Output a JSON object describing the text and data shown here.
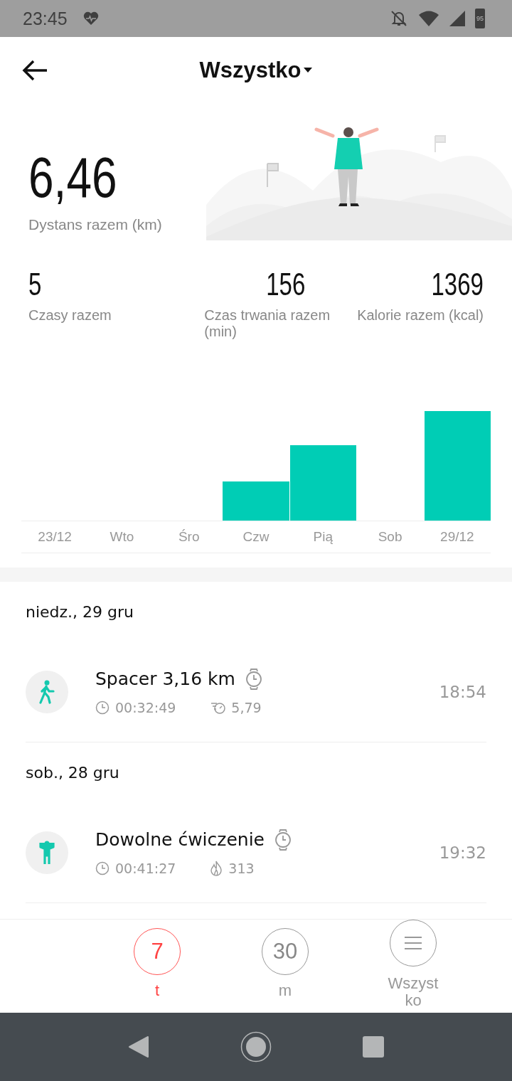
{
  "status_bar": {
    "time": "23:45",
    "battery": "95"
  },
  "header": {
    "title": "Wszystko"
  },
  "summary": {
    "distance": "6,46",
    "distance_label": "Dystans razem (km)",
    "stats": [
      {
        "value": "5",
        "label": "Czasy razem"
      },
      {
        "value": "156",
        "label": "Czas trwania razem (min)"
      },
      {
        "value": "1369",
        "label": "Kalorie razem (kcal)"
      }
    ]
  },
  "chart": {
    "days": [
      {
        "label": "23/12"
      },
      {
        "label": "Wto"
      },
      {
        "label": "Śro"
      },
      {
        "label": "Czw"
      },
      {
        "label": "Pią"
      },
      {
        "label": "Sob"
      },
      {
        "label": "29/12"
      }
    ]
  },
  "groups": [
    {
      "date": "niedz., 29 gru",
      "workouts": [
        {
          "kind": "walk",
          "title": "Spacer 3,16 km",
          "duration": "00:32:49",
          "metric": {
            "kind": "pace",
            "value": "5,79"
          },
          "time": "18:54"
        }
      ]
    },
    {
      "date": "sob., 28 gru",
      "workouts": [
        {
          "kind": "free",
          "title": "Dowolne ćwiczenie",
          "duration": "00:41:27",
          "metric": {
            "kind": "calories",
            "value": "313"
          },
          "time": "19:32"
        }
      ]
    }
  ],
  "periods": [
    {
      "kind": "number",
      "value": "7",
      "label": "t",
      "selected": true
    },
    {
      "kind": "number",
      "value": "30",
      "label": "m",
      "selected": false
    },
    {
      "kind": "menu",
      "label": "Wszystko",
      "selected": false
    }
  ]
}
